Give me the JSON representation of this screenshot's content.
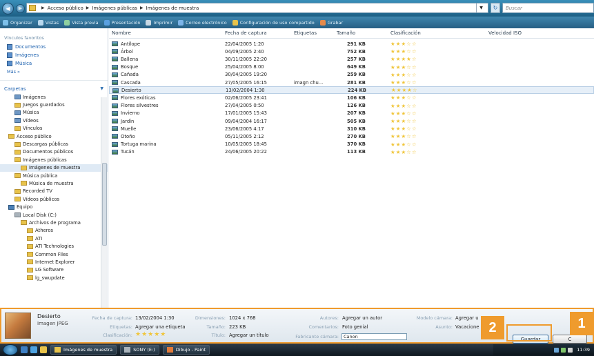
{
  "address": {
    "crumbs": [
      "Acceso público",
      "Imágenes públicas",
      "Imágenes de muestra"
    ],
    "search_placeholder": "Buscar"
  },
  "toolbar": {
    "items": [
      {
        "label": "Organizar",
        "icon": "organize-icon"
      },
      {
        "label": "Vistas",
        "icon": "views-icon"
      },
      {
        "label": "Vista previa",
        "icon": "preview-icon"
      },
      {
        "label": "Presentación",
        "icon": "slideshow-icon"
      },
      {
        "label": "Imprimir",
        "icon": "printer-icon"
      },
      {
        "label": "Correo electrónico",
        "icon": "email-icon"
      },
      {
        "label": "Configuración de uso compartido",
        "icon": "share-icon"
      },
      {
        "label": "Grabar",
        "icon": "burn-icon"
      }
    ]
  },
  "sidebar": {
    "favorites_title": "Vínculos favoritos",
    "favorites": [
      "Documentos",
      "Imágenes",
      "Música"
    ],
    "more": "Más",
    "folders_title": "Carpetas",
    "tree": [
      {
        "label": "Imágenes",
        "indent": 1,
        "kind": "blue"
      },
      {
        "label": "Juegos guardados",
        "indent": 1,
        "kind": "normal"
      },
      {
        "label": "Música",
        "indent": 1,
        "kind": "blue"
      },
      {
        "label": "Vídeos",
        "indent": 1,
        "kind": "blue"
      },
      {
        "label": "Vínculos",
        "indent": 1,
        "kind": "normal"
      },
      {
        "label": "Acceso público",
        "indent": 0,
        "kind": "normal"
      },
      {
        "label": "Descargas públicas",
        "indent": 1,
        "kind": "normal"
      },
      {
        "label": "Documentos públicos",
        "indent": 1,
        "kind": "normal"
      },
      {
        "label": "Imágenes públicas",
        "indent": 1,
        "kind": "normal"
      },
      {
        "label": "Imágenes de muestra",
        "indent": 2,
        "kind": "normal",
        "selected": true
      },
      {
        "label": "Música pública",
        "indent": 1,
        "kind": "normal"
      },
      {
        "label": "Música de muestra",
        "indent": 2,
        "kind": "normal"
      },
      {
        "label": "Recorded TV",
        "indent": 1,
        "kind": "normal"
      },
      {
        "label": "Vídeos públicos",
        "indent": 1,
        "kind": "normal"
      },
      {
        "label": "Equipo",
        "indent": 0,
        "kind": "comp"
      },
      {
        "label": "Local Disk (C:)",
        "indent": 1,
        "kind": "drive"
      },
      {
        "label": "Archivos de programa",
        "indent": 2,
        "kind": "normal"
      },
      {
        "label": "Atheros",
        "indent": 3,
        "kind": "normal"
      },
      {
        "label": "ATI",
        "indent": 3,
        "kind": "normal"
      },
      {
        "label": "ATI Technologies",
        "indent": 3,
        "kind": "normal"
      },
      {
        "label": "Common Files",
        "indent": 3,
        "kind": "normal"
      },
      {
        "label": "Internet Explorer",
        "indent": 3,
        "kind": "normal"
      },
      {
        "label": "LG Software",
        "indent": 3,
        "kind": "normal"
      },
      {
        "label": "lg_swupdate",
        "indent": 3,
        "kind": "normal"
      }
    ]
  },
  "columns": [
    "Nombre",
    "Fecha de captura",
    "Etiquetas",
    "Tamaño",
    "Clasificación",
    "Velocidad ISO"
  ],
  "files": [
    {
      "name": "Antílope",
      "date": "22/04/2005 1:20",
      "tags": "",
      "size": "291 KB",
      "rating": 3
    },
    {
      "name": "Árbol",
      "date": "04/09/2005 2:40",
      "tags": "",
      "size": "752 KB",
      "rating": 3
    },
    {
      "name": "Ballena",
      "date": "30/11/2005 22:20",
      "tags": "",
      "size": "257 KB",
      "rating": 4
    },
    {
      "name": "Bosque",
      "date": "25/04/2005 8:00",
      "tags": "",
      "size": "649 KB",
      "rating": 3
    },
    {
      "name": "Cañada",
      "date": "30/04/2005 19:20",
      "tags": "",
      "size": "259 KB",
      "rating": 3
    },
    {
      "name": "Cascada",
      "date": "27/05/2005 16:15",
      "tags": "imagn chu...",
      "size": "281 KB",
      "rating": 3
    },
    {
      "name": "Desierto",
      "date": "13/02/2004 1:30",
      "tags": "",
      "size": "224 KB",
      "rating": 4,
      "selected": true
    },
    {
      "name": "Flores exóticas",
      "date": "02/06/2005 23:41",
      "tags": "",
      "size": "106 KB",
      "rating": 3
    },
    {
      "name": "Flores silvestres",
      "date": "27/04/2005 0:50",
      "tags": "",
      "size": "126 KB",
      "rating": 3
    },
    {
      "name": "Invierno",
      "date": "17/01/2005 15:43",
      "tags": "",
      "size": "207 KB",
      "rating": 3
    },
    {
      "name": "Jardín",
      "date": "09/04/2004 16:17",
      "tags": "",
      "size": "505 KB",
      "rating": 3
    },
    {
      "name": "Muelle",
      "date": "23/06/2005 4:17",
      "tags": "",
      "size": "310 KB",
      "rating": 3
    },
    {
      "name": "Otoño",
      "date": "05/11/2005 2:12",
      "tags": "",
      "size": "270 KB",
      "rating": 3
    },
    {
      "name": "Tortuga marina",
      "date": "10/05/2005 18:45",
      "tags": "",
      "size": "370 KB",
      "rating": 3
    },
    {
      "name": "Tucán",
      "date": "24/06/2005 20:22",
      "tags": "",
      "size": "113 KB",
      "rating": 3
    }
  ],
  "details": {
    "name": "Desierto",
    "type": "Imagen JPEG",
    "capture_label": "Fecha de captura:",
    "capture_value": "13/02/2004 1:30",
    "tags_label": "Etiquetas:",
    "tags_value": "Agregar una etiqueta",
    "rating_label": "Clasificación:",
    "dims_label": "Dimensiones:",
    "dims_value": "1024 x 768",
    "size_label": "Tamaño:",
    "size_value": "223 KB",
    "title_label": "Título:",
    "title_value": "Agregar un título",
    "authors_label": "Autores:",
    "authors_value": "Agregar un autor",
    "comments_label": "Comentarios:",
    "comments_value": "Foto genial",
    "maker_label": "Fabricante cámara:",
    "maker_value": "Canon",
    "model_label": "Modelo cámara:",
    "model_value": "Agregar u",
    "subject_label": "Asunto:",
    "subject_value": "Vacacione",
    "save": "Guardar",
    "cancel": "C",
    "rating": 5
  },
  "callouts": {
    "one": "1",
    "two": "2"
  },
  "taskbar": {
    "tasks": [
      "Imágenes de muestra",
      "SONY (E:)",
      "Dibujo - Paint"
    ],
    "clock": "11:39"
  }
}
